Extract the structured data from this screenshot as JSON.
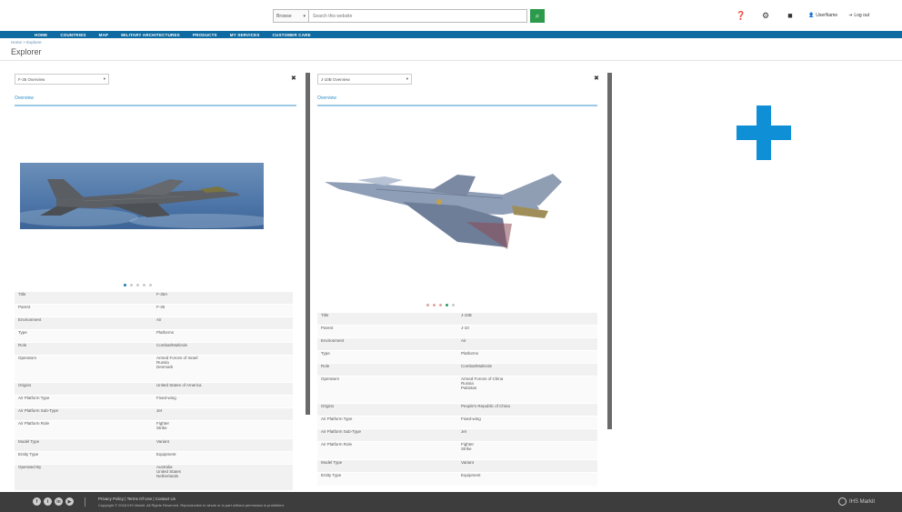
{
  "header": {
    "search_scope": "Browse",
    "search_placeholder": "Search this website",
    "user_label": "UserName",
    "logout_label": "Log out"
  },
  "nav": {
    "items": [
      "HOME",
      "COUNTRIES",
      "MAP",
      "MILITARY ARCHITECTURES",
      "PRODUCTS",
      "MY SERVICES",
      "CUSTOMER CARE"
    ]
  },
  "breadcrumb": "Home > Explorer",
  "page_title": "Explorer",
  "panels": [
    {
      "select_label": "F-35 Overview",
      "tab_label": "Overview",
      "carousel_total": 5,
      "carousel_active": 1,
      "attributes": [
        {
          "label": "Title",
          "value": "F-35A"
        },
        {
          "label": "Parent",
          "value": "F-35"
        },
        {
          "label": "Environment",
          "value": "Air"
        },
        {
          "label": "Type",
          "value": "Platforms"
        },
        {
          "label": "Role",
          "value": "Combat/Multirole"
        },
        {
          "label": "Operators",
          "value": "Armed Forces of Israel\nRussia\nDenmark"
        },
        {
          "label": "Origins",
          "value": "United States of America"
        },
        {
          "label": "Air Platform Type",
          "value": "Fixed-wing"
        },
        {
          "label": "Air Platform Sub-Type",
          "value": "Jet"
        },
        {
          "label": "Air Platform Role",
          "value": "Fighter\nStrike"
        },
        {
          "label": "Model Type",
          "value": "Variant"
        },
        {
          "label": "Entity Type",
          "value": "Equipment"
        },
        {
          "label": "Operated By",
          "value": "Australia\nUnited States\nNetherlands"
        }
      ]
    },
    {
      "select_label": "J-10B Overview",
      "tab_label": "Overview",
      "carousel_total": 5,
      "carousel_active": 4,
      "attributes": [
        {
          "label": "Title",
          "value": "J-10B"
        },
        {
          "label": "Parent",
          "value": "J-10"
        },
        {
          "label": "Environment",
          "value": "Air"
        },
        {
          "label": "Type",
          "value": "Platforms"
        },
        {
          "label": "Role",
          "value": "Combat/Multirole"
        },
        {
          "label": "Operators",
          "value": "Armed Forces of China\nRussia\nPakistan"
        },
        {
          "label": "Origins",
          "value": "People's Republic of China"
        },
        {
          "label": "Air Platform Type",
          "value": "Fixed-wing"
        },
        {
          "label": "Air Platform Sub-Type",
          "value": "Jet"
        },
        {
          "label": "Air Platform Role",
          "value": "Fighter\nStrike"
        },
        {
          "label": "Model Type",
          "value": "Variant"
        },
        {
          "label": "Entity Type",
          "value": "Equipment"
        }
      ]
    }
  ],
  "footer": {
    "links": "Privacy Policy | Terms Of Use | Contact Us",
    "copyright": "Copyright © 2018 IHS Markit. All Rights Reserved. Reproduction in whole or in part without permission is prohibited.",
    "logo_text": "IHS Markit"
  },
  "colors": {
    "nav_blue": "#0e6aa0",
    "accent_blue": "#0e8fd6",
    "search_green": "#2b9a4a",
    "footer_dark": "#3d3d3d"
  }
}
